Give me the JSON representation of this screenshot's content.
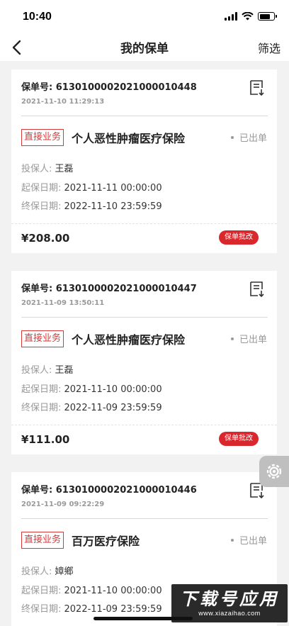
{
  "status_bar": {
    "time": "10:40"
  },
  "nav": {
    "title": "我的保单",
    "filter_label": "筛选"
  },
  "labels": {
    "policy_no": "保单号: ",
    "holder": "投保人: ",
    "start": "起保日期: ",
    "end": "终保日期: "
  },
  "policies": [
    {
      "policy_no": "6130100002021000010448",
      "created": "2021-11-10 11:29:13",
      "tag": "直接业务",
      "product": "个人恶性肿瘤医疗保险",
      "status": "已出单",
      "holder": "王磊",
      "start": "2021-11-11 00:00:00",
      "end": "2022-11-10 23:59:59",
      "price": "¥208.00",
      "action": "保单批改"
    },
    {
      "policy_no": "6130100002021000010447",
      "created": "2021-11-09 13:50:11",
      "tag": "直接业务",
      "product": "个人恶性肿瘤医疗保险",
      "status": "已出单",
      "holder": "王磊",
      "start": "2021-11-10 00:00:00",
      "end": "2022-11-09 23:59:59",
      "price": "¥111.00",
      "action": "保单批改"
    },
    {
      "policy_no": "6130100002021000010446",
      "created": "2021-11-09 09:22:29",
      "tag": "直接业务",
      "product": "百万医疗保险",
      "status": "已出单",
      "holder": "嫜鄉",
      "start": "2021-11-10 00:00:00",
      "end": "2022-11-09 23:59:59",
      "price": "",
      "action": ""
    }
  ],
  "watermark": {
    "main": "下载号应用",
    "sub": "www.xiazaihao.com"
  },
  "colors": {
    "accent": "#d8282e",
    "tag_border": "#d63a3a"
  },
  "icons": [
    "back-icon",
    "document-icon",
    "settings-icon"
  ]
}
